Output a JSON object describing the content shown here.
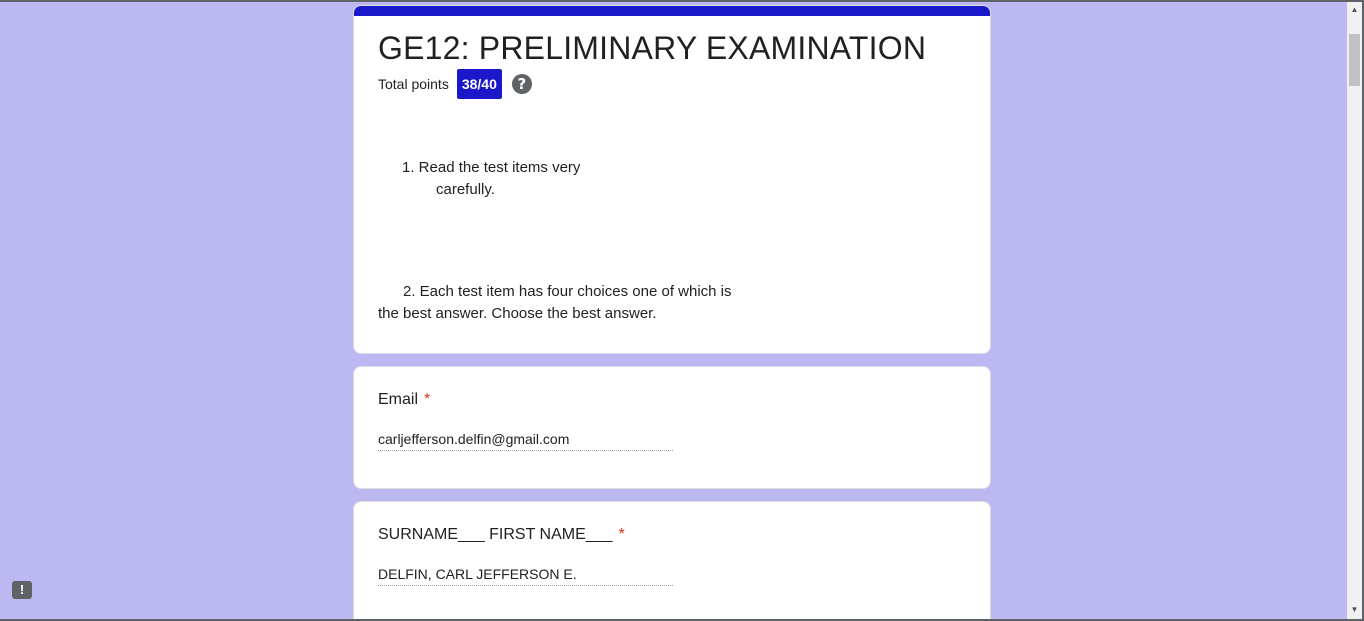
{
  "form": {
    "title": "GE12: PRELIMINARY EXAMINATION",
    "points_label": "Total points",
    "score": "38/40",
    "help_icon": "?",
    "instructions": [
      {
        "line1": "1. Read the test items very",
        "line2": "carefully."
      },
      {
        "line1": "2. Each test item has four choices one of which is",
        "line2": "the best answer. Choose the best answer."
      }
    ],
    "accent_color": "#1a18c9",
    "background_color": "#bcb8f2"
  },
  "questions": [
    {
      "label": "Email",
      "required_mark": "*",
      "answer": "carljefferson.delfin@gmail.com"
    },
    {
      "label": "SURNAME___ FIRST NAME___",
      "required_mark": "*",
      "answer": "DELFIN, CARL JEFFERSON E."
    }
  ],
  "feedback": {
    "icon": "report-problem-icon",
    "glyph": "!"
  },
  "scrollbar": {
    "up_glyph": "▲",
    "down_glyph": "▼"
  }
}
